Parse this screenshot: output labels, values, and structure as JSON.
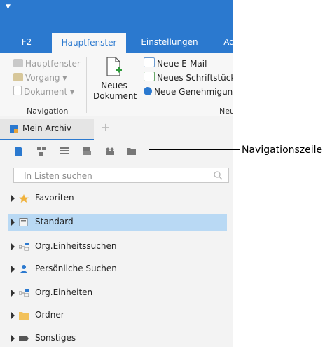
{
  "ribbon_tabs": [
    "F2",
    "Hauptfenster",
    "Einstellungen",
    "Ad"
  ],
  "navigation_group": {
    "items": [
      "Hauptfenster",
      "Vorgang",
      "Dokument"
    ],
    "label": "Navigation"
  },
  "new_group": {
    "big_button": "Neues Dokument",
    "items": [
      "Neue E-Mail",
      "Neues Schriftstück",
      "Neue Genehmigung"
    ],
    "label": "Neu"
  },
  "doc_tab": {
    "label": "Mein Archiv",
    "add": "+"
  },
  "search": {
    "placeholder": "In Listen suchen"
  },
  "tree": [
    {
      "label": "Favoriten",
      "icon": "star-icon"
    },
    {
      "label": "Standard",
      "icon": "list-icon",
      "selected": true
    },
    {
      "label": "Org.Einheitssuchen",
      "icon": "org-icon"
    },
    {
      "label": "Persönliche Suchen",
      "icon": "person-icon"
    },
    {
      "label": "Org.Einheiten",
      "icon": "org-icon"
    },
    {
      "label": "Ordner",
      "icon": "folder-icon"
    },
    {
      "label": "Sonstiges",
      "icon": "misc-icon"
    }
  ],
  "callout": "Navigationszeile",
  "colors": {
    "accent": "#2b79cf",
    "selection": "#b9d9f4"
  }
}
